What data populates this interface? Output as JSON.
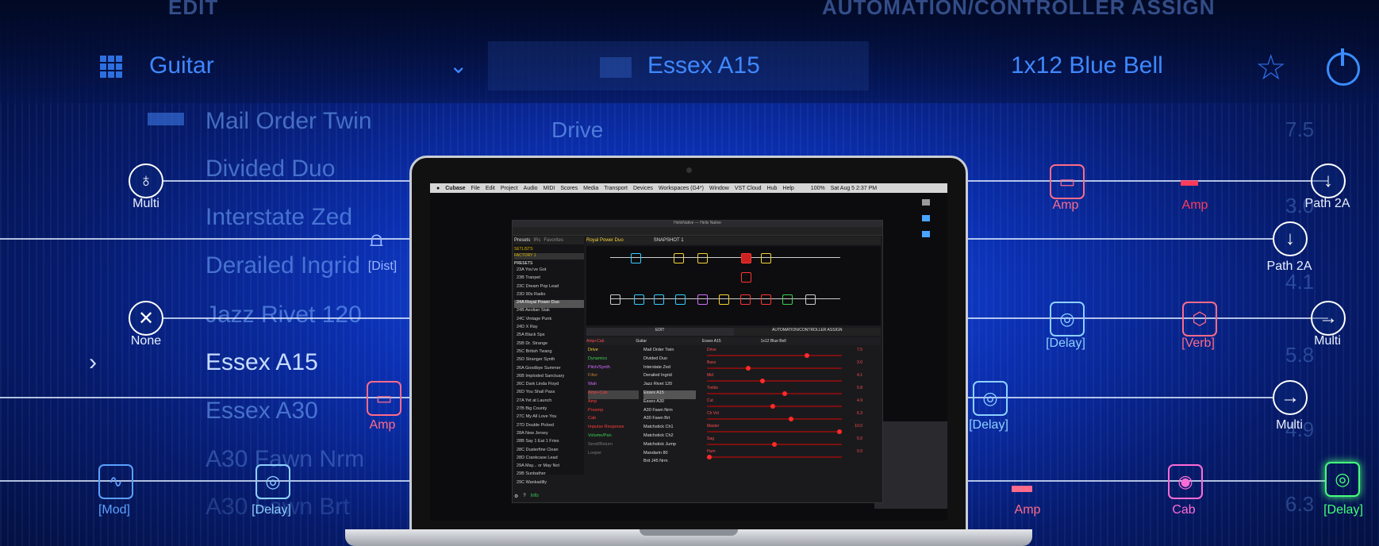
{
  "header": {
    "edit_label": "EDIT",
    "automation_label": "AUTOMATION/CONTROLLER ASSIGN",
    "category": "Guitar",
    "current_model": "Essex A15",
    "cab_name": "1x12 Blue Bell",
    "param_drive": "Drive"
  },
  "presets": [
    "Mail Order Twin",
    "Divided Duo",
    "Interstate Zed",
    "Derailed Ingrid",
    "Jazz Rivet 120",
    "Essex A15",
    "Essex A30",
    "A30 Fawn Nrm",
    "A30 Fawn Brt"
  ],
  "signal": {
    "multi": "Multi",
    "none": "None",
    "dist": "[Dist]",
    "amp": "Amp",
    "amp2": "Amp",
    "path2a": "Path 2A",
    "path2a_b": "Path 2A",
    "delay": "[Delay]",
    "delay2": "[Delay]",
    "delay3": "[Delay]",
    "verb": "[Verb]",
    "multi2": "Multi",
    "multi3": "Multi",
    "mod": "[Mod]",
    "amp3": "Amp",
    "amp4": "Amp",
    "cab": "Cab",
    "delay_green": "[Delay]"
  },
  "ghost_values": [
    "7.5",
    "3.0",
    "4.1",
    "5.8",
    "4.9",
    "6.3"
  ],
  "mac_menubar": {
    "app": "Cubase",
    "items": [
      "File",
      "Edit",
      "Project",
      "Audio",
      "MIDI",
      "Scores",
      "Media",
      "Transport",
      "Devices",
      "Workspaces (G4*)",
      "Window",
      "VST Cloud",
      "Hub",
      "Help"
    ],
    "status": "100%",
    "datetime": "Sat Aug 5 2:37 PM"
  },
  "app": {
    "title": "HelixNative — Helix Native",
    "tab_presets": "Presets",
    "tab_ir": "IRs",
    "tab_favorites": "Favorites",
    "preset_name": "Royal Power Duo",
    "snapshot": "SNAPSHOT 1",
    "setlist_label": "SETLISTS",
    "setlist": "FACTORY 1",
    "presets_header": "PRESETS",
    "preset_list": [
      "23A You've Got",
      "23B Tranpet",
      "23C Dream Pop Lead",
      "23D 90s Radio",
      "24A Royal Power Duo",
      "24B Aeolian Stak",
      "24C Vintage Punk",
      "24D X Ray",
      "25A Black Sps",
      "25B Dr. Strange",
      "25C British Twang",
      "25D Stranger Synth",
      "26A Goodbye Summer",
      "26B Imploded Sanctuary",
      "26C Dark Linda Floyd",
      "26D You Shall Pass",
      "27A Yet at Launch",
      "27B Big County",
      "27C My All Love You",
      "27D Double Picked",
      "28A New Jersey",
      "28B Say 1 Eat 1 Fries",
      "28C Dusterfine Clean",
      "28D Crankcase Lead",
      "29A May... or May Not",
      "29B Sunbather",
      "29C Wankadilly"
    ],
    "edit_tab": "EDIT",
    "automation_tab": "AUTOMATION/CONTROLLER ASSIGN",
    "amp_cab": "Amp+Cab",
    "guitar": "Guitar",
    "essex": "Essex A15",
    "cab": "1x12 Blue Bell",
    "categories": [
      "Drive",
      "Dynamics",
      "Pitch/Synth",
      "Filter",
      "Wah",
      "Amp+Cab",
      "Amp",
      "Preamp",
      "Cab",
      "Impulse Response",
      "Volume/Pan",
      "Send/Return",
      "Looper"
    ],
    "category_colors": [
      "#f6d234",
      "#3ecf4f",
      "#d46bff",
      "#b57a2f",
      "#d46bff",
      "#ff3b3b",
      "#ff3b3b",
      "#ff3b3b",
      "#ff3b3b",
      "#ff3b3b",
      "#3ecf4f",
      "#7b7b7b",
      "#7b7b7b"
    ],
    "models": [
      "Mail Order Twin",
      "Divided Duo",
      "Interstate Zed",
      "Derailed Ingrid",
      "Jazz Rivet 120",
      "Essex A15",
      "Essex A30",
      "A30 Fawn Nrm",
      "A30 Fawn Brt",
      "Matchstick Ch1",
      "Matchstick Ch2",
      "Matchstick Jump",
      "Mandarin 80",
      "Brit J45 Nrm"
    ],
    "params": [
      {
        "label": "Drive",
        "value": "7.5",
        "level": 0.75
      },
      {
        "label": "Bass",
        "value": "3.0",
        "level": 0.3
      },
      {
        "label": "Mid",
        "value": "4.1",
        "level": 0.41
      },
      {
        "label": "Treble",
        "value": "5.8",
        "level": 0.58
      },
      {
        "label": "Cut",
        "value": "4.9",
        "level": 0.49
      },
      {
        "label": "Ch Vol",
        "value": "6.3",
        "level": 0.63
      },
      {
        "label": "Master",
        "value": "10.0",
        "level": 1.0
      },
      {
        "label": "Sag",
        "value": "5.0",
        "level": 0.5
      },
      {
        "label": "Hum",
        "value": "0.0",
        "level": 0.0
      }
    ],
    "footer_tip": "Info"
  }
}
